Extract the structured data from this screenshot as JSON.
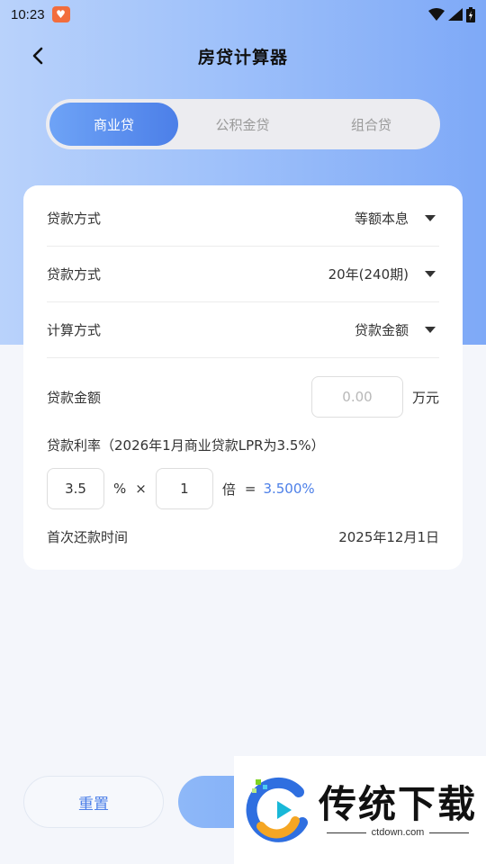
{
  "status_bar": {
    "time": "10:23"
  },
  "header": {
    "title": "房贷计算器"
  },
  "tabs": [
    {
      "label": "商业贷",
      "active": true
    },
    {
      "label": "公积金贷",
      "active": false
    },
    {
      "label": "组合贷",
      "active": false
    }
  ],
  "form": {
    "repayment_method": {
      "label": "贷款方式",
      "value": "等额本息"
    },
    "loan_term": {
      "label": "贷款方式",
      "value": "20年(240期)"
    },
    "calc_method": {
      "label": "计算方式",
      "value": "贷款金额"
    },
    "loan_amount": {
      "label": "贷款金额",
      "placeholder": "0.00",
      "unit": "万元"
    },
    "rate": {
      "title": "贷款利率（2026年1月商业贷款LPR为3.5%）",
      "base": "3.5",
      "percent_sign": "%",
      "times_sign": "×",
      "multiplier": "1",
      "multiplier_unit": "倍",
      "equals": "=",
      "result": "3.500%"
    },
    "first_payment": {
      "label": "首次还款时间",
      "value": "2025年12月1日"
    }
  },
  "actions": {
    "reset_label": "重置"
  },
  "watermark": {
    "title": "传统下载",
    "url": "ctdown.com"
  },
  "colors": {
    "accent": "#4c7fe8",
    "hero_gradient_start": "#b9d2fb",
    "hero_gradient_end": "#7ea9f7"
  }
}
